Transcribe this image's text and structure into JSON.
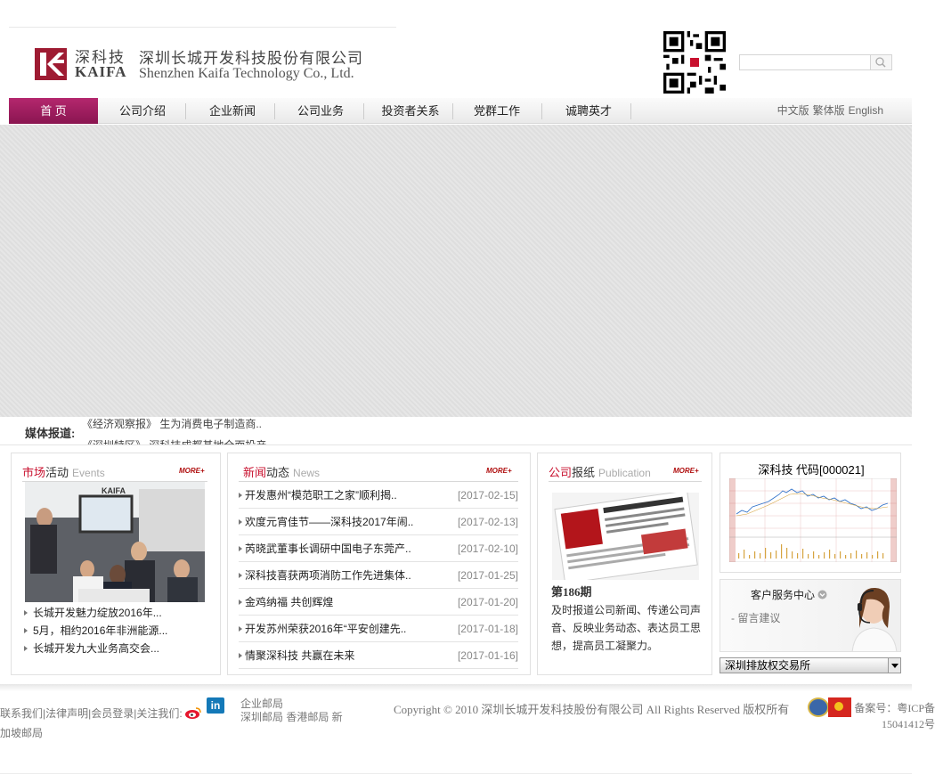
{
  "header": {
    "logo_cn_short": "深科技",
    "logo_en_short": "KAIFA",
    "company_name_cn": "深圳长城开发科技股份有限公司",
    "company_name_en": "Shenzhen Kaifa Technology Co., Ltd.",
    "search_placeholder": ""
  },
  "nav": {
    "items": [
      {
        "label": "首  页",
        "active": true
      },
      {
        "label": "公司介绍"
      },
      {
        "label": "企业新闻"
      },
      {
        "label": "公司业务"
      },
      {
        "label": "投资者关系"
      },
      {
        "label": "党群工作"
      },
      {
        "label": "诚聘英才"
      }
    ],
    "languages": [
      "中文版",
      "繁体版",
      "English"
    ]
  },
  "media": {
    "label": "媒体报道:",
    "lines": [
      "《经济观察报》  生为消费电子制造商..",
      "《深圳特区》  深科技成都基地全面投产.."
    ]
  },
  "events": {
    "title_red": "市场",
    "title_dark": "活动",
    "title_en": "Events",
    "more": "MORE+",
    "items": [
      "长城开发魅力绽放2016年...",
      "5月，相约2016年非洲能源...",
      "长城开发九大业务高交会..."
    ]
  },
  "news": {
    "title_red": "新闻",
    "title_dark": "动态",
    "title_en": "News",
    "more": "MORE+",
    "items": [
      {
        "title": "开发惠州“模范职工之家”顺利揭..",
        "date": "[2017-02-15]"
      },
      {
        "title": "欢度元宵佳节——深科技2017年闹..",
        "date": "[2017-02-13]"
      },
      {
        "title": "芮晓武董事长调研中国电子东莞产..",
        "date": "[2017-02-10]"
      },
      {
        "title": "深科技喜获两项消防工作先进集体..",
        "date": "[2017-01-25]"
      },
      {
        "title": "金鸡纳福 共创辉煌",
        "date": "[2017-01-20]"
      },
      {
        "title": "开发苏州荣获2016年“平安创建先..",
        "date": "[2017-01-18]"
      },
      {
        "title": "情聚深科技 共赢在未来",
        "date": "[2017-01-16]"
      }
    ]
  },
  "publication": {
    "title_red": "公司",
    "title_dark": "报纸",
    "title_en": "Publication",
    "more": "MORE+",
    "issue": "第186期",
    "description": "及时报道公司新闻、传递公司声音、反映业务动态、表达员工思想，提高员工凝聚力。"
  },
  "stock": {
    "title": "深科技 代码[000021]"
  },
  "service": {
    "title": "客户服务中心",
    "link": "- 留言建议"
  },
  "exchange": {
    "selected": "深圳排放权交易所"
  },
  "footer": {
    "links": "联系我们|法律声明|会员登录|关注我们:",
    "link2": "加坡邮局",
    "mail_title": "企业邮局",
    "mail_list": "深圳邮局 香港邮局 新",
    "copyright": "Copyright © 2010 深圳长城开发科技股份有限公司 All Rights Reserved 版权所有",
    "icp": "备案号：粤ICP备15041412号"
  },
  "colors": {
    "nav_active": "#9b1c5c",
    "accent_red": "#c8102e"
  }
}
